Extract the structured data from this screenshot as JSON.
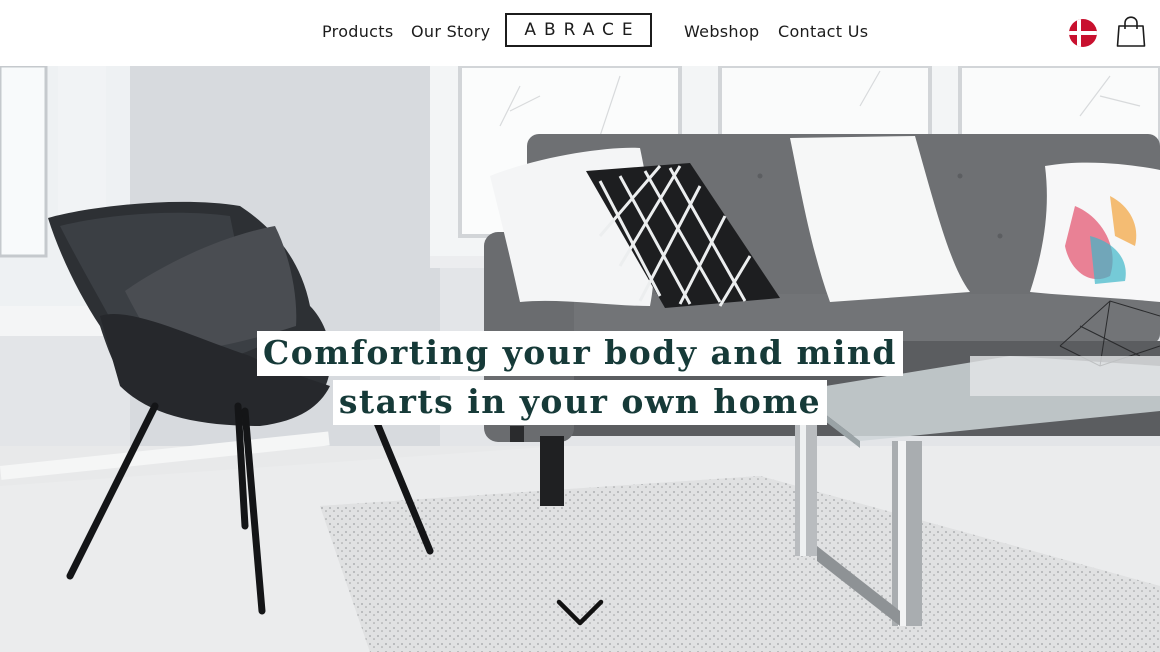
{
  "nav": {
    "left": [
      "Products",
      "Our Story"
    ],
    "right": [
      "Webshop",
      "Contact Us"
    ],
    "logo": "ABRACE"
  },
  "header_icons": {
    "language": "danish-flag-icon",
    "cart": "shopping-bag-icon"
  },
  "hero": {
    "headline_line1": "Comforting your body and mind",
    "headline_line2": "starts in your own home",
    "scroll": "chevron-down-icon"
  },
  "colors": {
    "headline": "#163a38",
    "flag_red": "#c8102e",
    "text": "#1c1c1c"
  }
}
